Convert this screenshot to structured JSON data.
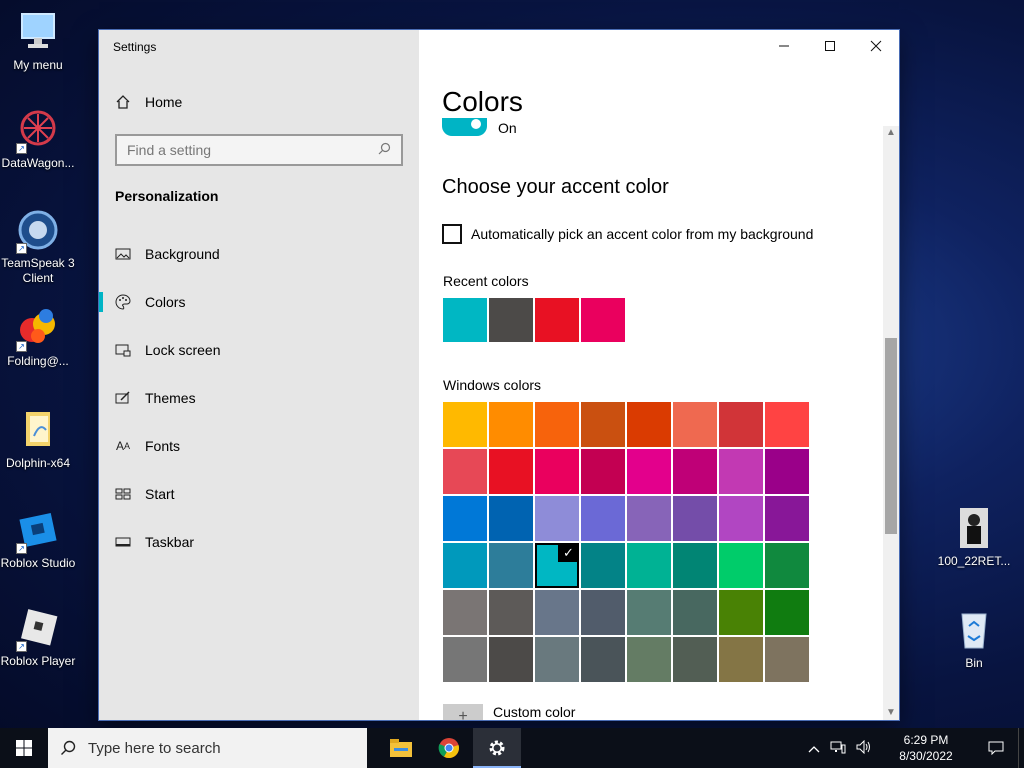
{
  "desktop_icons": [
    {
      "label": "My menu",
      "icon": "monitor-icon"
    },
    {
      "label": "DataWagon...",
      "icon": "datawagon-icon"
    },
    {
      "label": "TeamSpeak 3 Client",
      "icon": "teamspeak-icon"
    },
    {
      "label": "Folding@...",
      "icon": "folding-icon"
    },
    {
      "label": "Dolphin-x64",
      "icon": "folder-icon"
    },
    {
      "label": "Roblox Studio",
      "icon": "roblox-studio-icon"
    },
    {
      "label": "Roblox Player",
      "icon": "roblox-player-icon"
    },
    {
      "label": "100_22RET...",
      "icon": "photo-icon"
    },
    {
      "label": "Bin",
      "icon": "recycle-bin-icon"
    }
  ],
  "window": {
    "title": "Settings",
    "controls": {
      "minimize": "—",
      "maximize": "☐",
      "close": "✕"
    }
  },
  "nav": {
    "home": "Home",
    "search_placeholder": "Find a setting",
    "section": "Personalization",
    "items": [
      {
        "label": "Background",
        "icon": "image-icon"
      },
      {
        "label": "Colors",
        "icon": "palette-icon",
        "active": true
      },
      {
        "label": "Lock screen",
        "icon": "lock-screen-icon"
      },
      {
        "label": "Themes",
        "icon": "brush-icon"
      },
      {
        "label": "Fonts",
        "icon": "font-icon"
      },
      {
        "label": "Start",
        "icon": "start-icon"
      },
      {
        "label": "Taskbar",
        "icon": "taskbar-icon"
      }
    ]
  },
  "content": {
    "title": "Colors",
    "toggle_label": "On",
    "accent_heading": "Choose your accent color",
    "auto_pick_label": "Automatically pick an accent color from my background",
    "recent_label": "Recent colors",
    "recent_colors": [
      "#00B7C3",
      "#4C4A48",
      "#E81123",
      "#EA005E"
    ],
    "windows_label": "Windows colors",
    "windows_colors": [
      "#FFB900",
      "#FF8C00",
      "#F7630C",
      "#CA5010",
      "#DA3B01",
      "#EF6950",
      "#D13438",
      "#FF4343",
      "#E74856",
      "#E81123",
      "#EA005E",
      "#C30052",
      "#E3008C",
      "#BF0077",
      "#C239B3",
      "#9A0089",
      "#0078D7",
      "#0063B1",
      "#8E8CD8",
      "#6B69D6",
      "#8764B8",
      "#744DA9",
      "#B146C2",
      "#881798",
      "#0099BC",
      "#2D7D9A",
      "#00B7C3",
      "#038387",
      "#00B294",
      "#018574",
      "#00CC6A",
      "#10893E",
      "#7A7574",
      "#5D5A58",
      "#68768A",
      "#515C6B",
      "#567C73",
      "#486860",
      "#498205",
      "#107C10",
      "#767676",
      "#4C4A48",
      "#69797E",
      "#4A5459",
      "#647C64",
      "#525E54",
      "#847545",
      "#7E735F"
    ],
    "selected_index": 26,
    "custom_color_label": "Custom color"
  },
  "taskbar": {
    "search_placeholder": "Type here to search",
    "apps": [
      {
        "name": "file-explorer-icon"
      },
      {
        "name": "chrome-icon"
      },
      {
        "name": "settings-gear-icon",
        "active": true
      }
    ],
    "time": "6:29 PM",
    "date": "8/30/2022"
  }
}
